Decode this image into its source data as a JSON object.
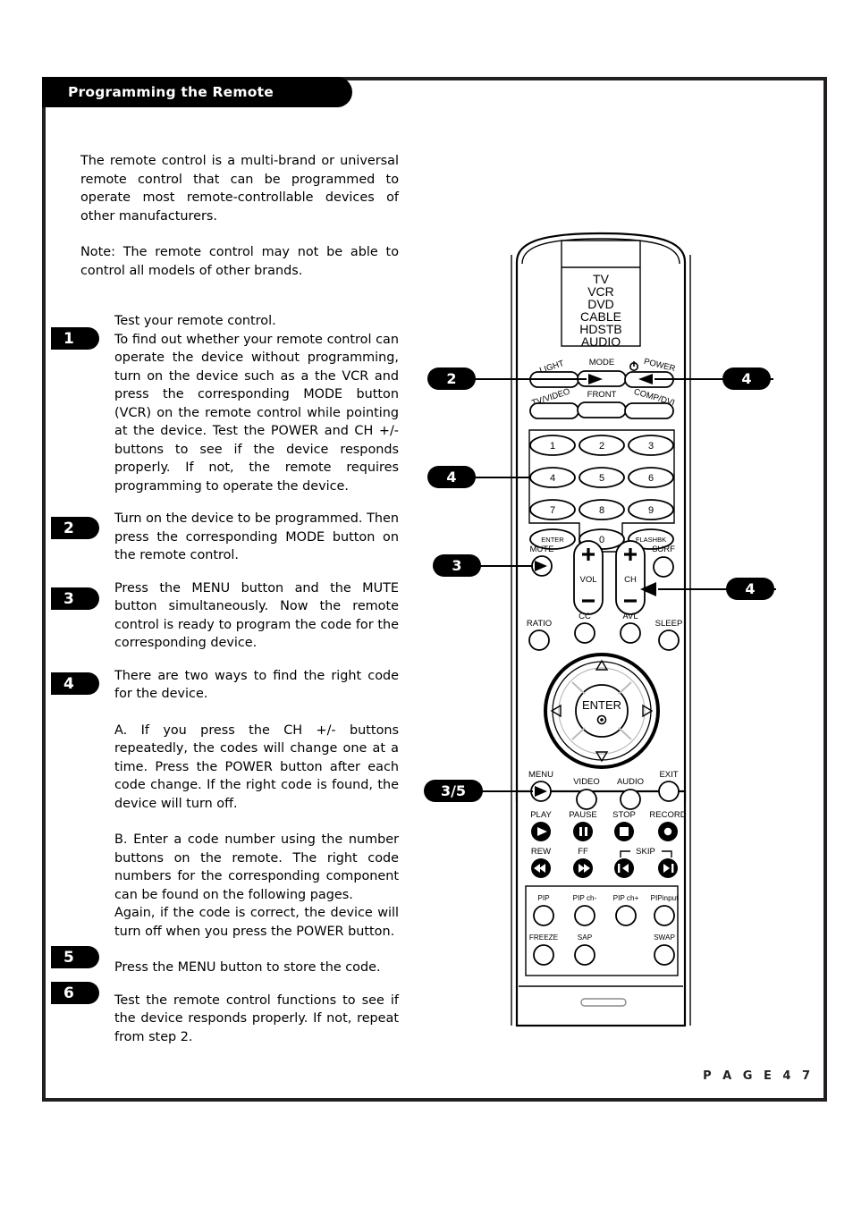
{
  "header": {
    "title": "Programming the Remote"
  },
  "intro": {
    "paragraph1": "The remote control is a multi-brand or universal remote control that can be programmed to operate most remote-controllable devices of other manufacturers.",
    "paragraph2": "Note: The remote control may not be able to control all models of other brands."
  },
  "steps": [
    {
      "number": "1",
      "line1": "Test your remote control.",
      "body": "To find out whether your remote control can operate the device without programming, turn on the device such as a the VCR and press the corresponding MODE button (VCR) on the remote control while pointing at the device. Test the POWER and CH +/- buttons to see if the device responds properly. If not, the remote requires programming to operate the device."
    },
    {
      "number": "2",
      "body": "Turn on the device to be programmed. Then press the corresponding MODE button on the remote control."
    },
    {
      "number": "3",
      "body": "Press the MENU button and the MUTE button simultaneously. Now the remote control is ready to program the code for the corresponding device."
    },
    {
      "number": "4",
      "body": "There are two ways to find the right code for the device.",
      "option_a": "A. If  you press the CH +/- buttons repeatedly, the codes will change one at a time. Press the POWER button after each code change. If the right code is found, the device will turn off.",
      "option_b": "B. Enter a code number using the number buttons on the remote. The right code numbers for the corresponding component can be found on the following pages.",
      "option_b_extra": "Again, if the code is correct, the device will turn off when you press the POWER button."
    },
    {
      "number": "5",
      "body": "Press the MENU button to store the code."
    },
    {
      "number": "6",
      "body": "Test the remote control functions to see if the device responds properly. If not, repeat from step 2."
    }
  ],
  "footer": {
    "page_label": "P A G E   4 7"
  },
  "remote": {
    "mode_list": [
      "TV",
      "VCR",
      "DVD",
      "CABLE",
      "HDSTB",
      "AUDIO"
    ],
    "row_light_mode_power": [
      "LIGHT",
      "MODE",
      "POWER"
    ],
    "row_inputs": [
      "TV/VIDEO",
      "FRONT",
      "COMP/DVI"
    ],
    "keypad": [
      "1",
      "2",
      "3",
      "4",
      "5",
      "6",
      "7",
      "8",
      "9"
    ],
    "keypad_bottom": [
      "ENTER",
      "0",
      "FLASHBK"
    ],
    "volume_label": "VOL",
    "channel_label": "CH",
    "mute_label": "MUTE",
    "surf_label": "SURF",
    "row_ratio": [
      "RATIO",
      "CC",
      "AVL",
      "SLEEP"
    ],
    "wheel_center": "ENTER",
    "row_menu": [
      "MENU",
      "VIDEO",
      "AUDIO",
      "EXIT"
    ],
    "row_transport1": [
      "PLAY",
      "PAUSE",
      "STOP",
      "RECORD"
    ],
    "row_transport2": [
      "REW",
      "FF"
    ],
    "skip_label": "SKIP",
    "row_pip1": [
      "PIP",
      "PIP ch-",
      "PIP ch+",
      "PIPinput"
    ],
    "row_pip2": [
      "FREEZE",
      "SAP",
      "SWAP"
    ]
  },
  "callouts": [
    {
      "id": "callout-mode",
      "label": "2"
    },
    {
      "id": "callout-power",
      "label": "4"
    },
    {
      "id": "callout-keypad",
      "label": "4"
    },
    {
      "id": "callout-mute",
      "label": "3"
    },
    {
      "id": "callout-ch",
      "label": "4"
    },
    {
      "id": "callout-menu",
      "label": "3/5"
    }
  ],
  "colors": {
    "frame": "#231f20",
    "badge": "#000000",
    "text": "#000000",
    "background": "#ffffff"
  }
}
